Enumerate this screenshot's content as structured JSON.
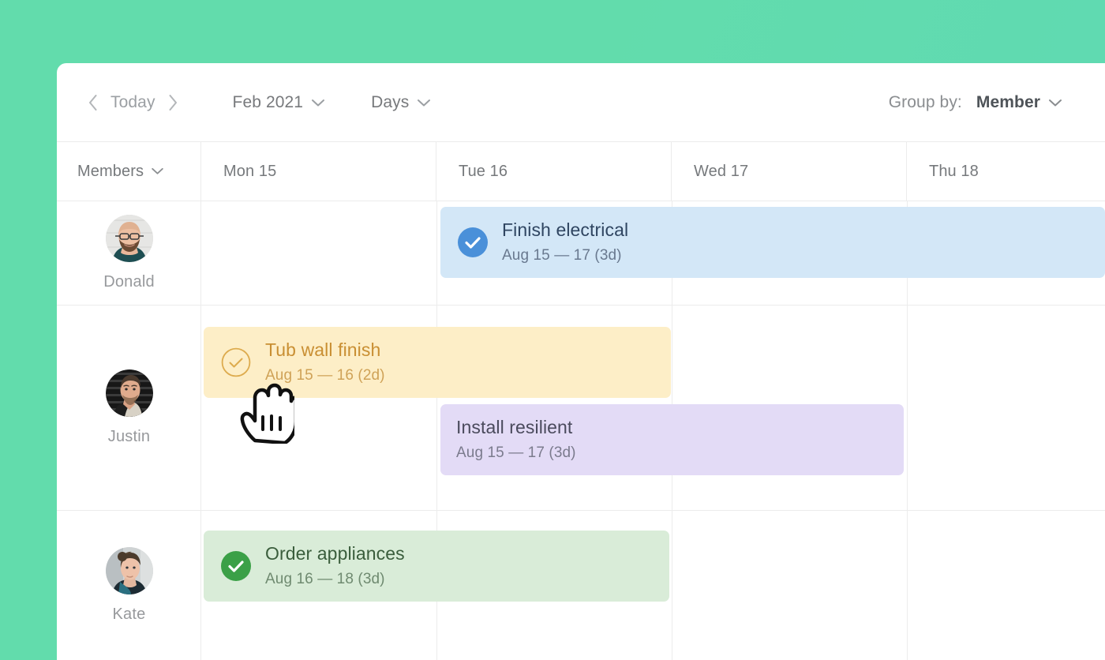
{
  "theme": {
    "background_start": "#62dcac",
    "background_end": "#5fd9b4",
    "card_background": "#ffffff",
    "grid_line": "#ececec"
  },
  "toolbar": {
    "prev_icon": "chevron-left-icon",
    "today_label": "Today",
    "next_icon": "chevron-right-icon",
    "month_label": "Feb 2021",
    "month_chevron_icon": "chevron-down-icon",
    "scale_label": "Days",
    "scale_chevron_icon": "chevron-down-icon",
    "group_by_label": "Group by:",
    "group_by_value": "Member",
    "group_by_chevron_icon": "chevron-down-icon"
  },
  "grid_header": {
    "member_column_label": "Members",
    "member_column_chevron_icon": "chevron-down-icon",
    "days": [
      {
        "label": "Mon 15"
      },
      {
        "label": "Tue 16"
      },
      {
        "label": "Wed 17"
      },
      {
        "label": "Thu 18"
      }
    ]
  },
  "members": [
    {
      "name": "Donald",
      "avatar_icon": "avatar-donald"
    },
    {
      "name": "Justin",
      "avatar_icon": "avatar-justin"
    },
    {
      "name": "Kate",
      "avatar_icon": "avatar-kate"
    }
  ],
  "tasks": [
    {
      "title": "Finish electrical",
      "dates": "Aug 15  — 17 (3d)",
      "color": "#d3e7f7",
      "accent": "#4a90d9",
      "status_icon": "check-circle-filled-icon",
      "member": "Donald"
    },
    {
      "title": "Tub wall finish",
      "dates": "Aug 15  — 16 (2d)",
      "color": "#fdeec7",
      "accent": "#ddab4e",
      "status_icon": "check-circle-outline-icon",
      "member": "Justin"
    },
    {
      "title": "Install resilient",
      "dates": "Aug 15  — 17 (3d)",
      "color": "#e3dbf6",
      "accent": "#8a7fb8",
      "status_icon": "none",
      "member": "Justin"
    },
    {
      "title": "Order appliances",
      "dates": "Aug 16  — 18 (3d)",
      "color": "#d9ecd8",
      "accent": "#3ba047",
      "status_icon": "check-circle-filled-icon",
      "member": "Kate"
    }
  ],
  "cursor": {
    "icon": "pointing-hand-cursor"
  }
}
